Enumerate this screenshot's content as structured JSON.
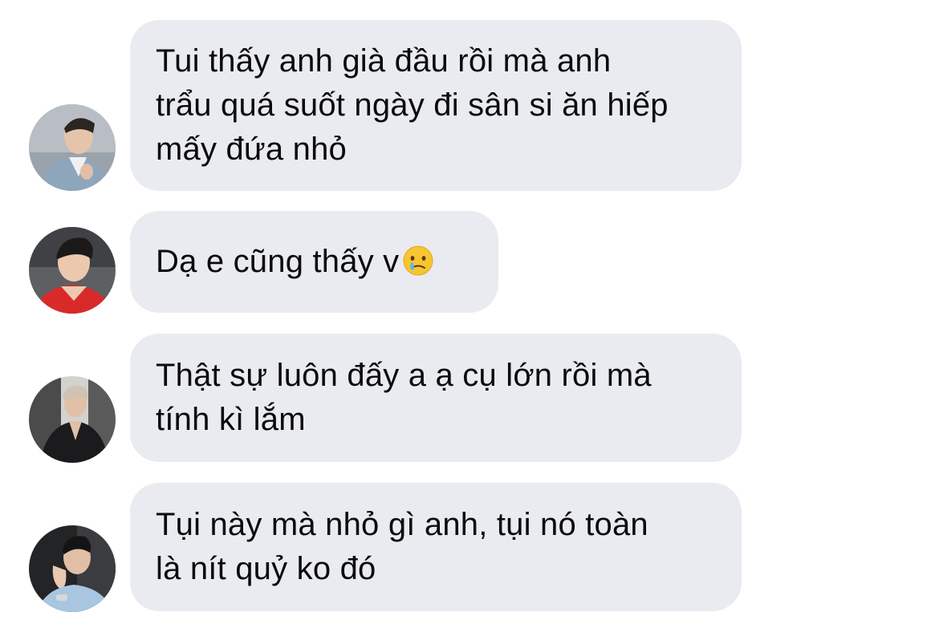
{
  "messages": [
    {
      "sender_avatar": "avatar-man-blue-suit",
      "text": "Tui thấy anh già đầu rồi mà anh\ntrẩu quá suốt ngày đi sân si ăn hiếp\nmấy đứa nhỏ"
    },
    {
      "sender_avatar": "avatar-man-red-jacket",
      "text": "Dạ e cũng thấy v",
      "emoji": "crying-face-emoji"
    },
    {
      "sender_avatar": "avatar-man-black-suit",
      "text": "Thật sự luôn đấy a ạ cụ lớn rồi mà\ntính kì lắm"
    },
    {
      "sender_avatar": "avatar-man-light-blue-shirt",
      "text": "Tụi này mà nhỏ gì anh, tụi nó toàn\nlà nít quỷ ko đó"
    }
  ],
  "colors": {
    "bubble_background": "#e9ebf0",
    "text": "#0b0b0c",
    "page_background": "#ffffff"
  }
}
